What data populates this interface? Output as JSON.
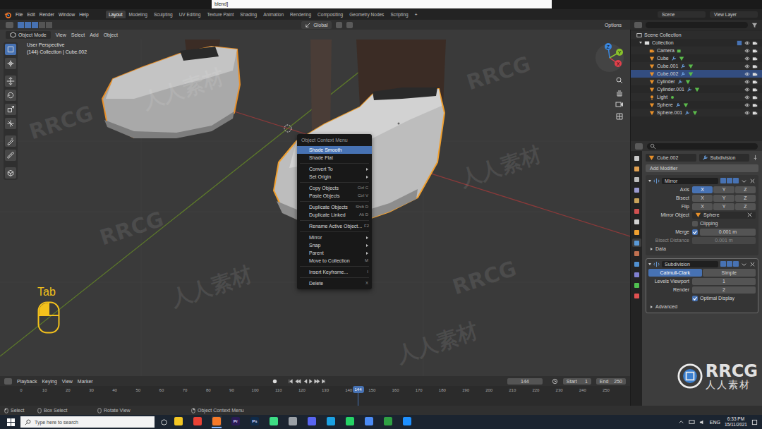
{
  "title_strip": {
    "text": "blend]"
  },
  "top_menu": [
    "File",
    "Edit",
    "Render",
    "Window",
    "Help"
  ],
  "workspaces": [
    {
      "label": "Layout",
      "selected": true
    },
    {
      "label": "Modeling",
      "selected": false
    },
    {
      "label": "Sculpting",
      "selected": false
    },
    {
      "label": "UV Editing",
      "selected": false
    },
    {
      "label": "Texture Paint",
      "selected": false
    },
    {
      "label": "Shading",
      "selected": false
    },
    {
      "label": "Animation",
      "selected": false
    },
    {
      "label": "Rendering",
      "selected": false
    },
    {
      "label": "Compositing",
      "selected": false
    },
    {
      "label": "Geometry Nodes",
      "selected": false
    },
    {
      "label": "Scripting",
      "selected": false
    }
  ],
  "add_workspace": "+",
  "scene": "Scene",
  "view_layer": "View Layer",
  "tool_header": {
    "orientation": "Global",
    "options": "Options"
  },
  "viewport_header": {
    "mode": "Object Mode",
    "menus": [
      "View",
      "Select",
      "Add",
      "Object"
    ]
  },
  "viewport": {
    "perspective": "User Perspective",
    "info": "(144) Collection | Cube.002",
    "gizmo": [
      {
        "axis": "X",
        "color": "#e2404c"
      },
      {
        "axis": "Y",
        "color": "#8ac22b"
      },
      {
        "axis": "Z",
        "color": "#3a87e0"
      }
    ]
  },
  "tools": [
    {
      "selected": true
    },
    {
      "selected": false
    },
    {
      "selected": false
    },
    {
      "selected": false
    },
    {
      "selected": false
    },
    {
      "selected": false
    },
    {
      "selected": false
    },
    {
      "selected": false
    },
    {
      "selected": false
    }
  ],
  "context_menu": {
    "title": "Object Context Menu",
    "items": [
      {
        "kind": "item",
        "label": "Shade Smooth",
        "shortcut": "",
        "submenu": false,
        "selected": true
      },
      {
        "kind": "item",
        "label": "Shade Flat",
        "shortcut": "",
        "submenu": false,
        "selected": false
      },
      {
        "kind": "separator"
      },
      {
        "kind": "item",
        "label": "Convert To",
        "shortcut": "",
        "submenu": true,
        "selected": false
      },
      {
        "kind": "item",
        "label": "Set Origin",
        "shortcut": "",
        "submenu": true,
        "selected": false
      },
      {
        "kind": "separator"
      },
      {
        "kind": "item",
        "label": "Copy Objects",
        "shortcut": "Ctrl C",
        "submenu": false,
        "selected": false
      },
      {
        "kind": "item",
        "label": "Paste Objects",
        "shortcut": "Ctrl V",
        "submenu": false,
        "selected": false
      },
      {
        "kind": "separator"
      },
      {
        "kind": "item",
        "label": "Duplicate Objects",
        "shortcut": "Shift D",
        "submenu": false,
        "selected": false
      },
      {
        "kind": "item",
        "label": "Duplicate Linked",
        "shortcut": "Alt D",
        "submenu": false,
        "selected": false
      },
      {
        "kind": "separator"
      },
      {
        "kind": "item",
        "label": "Rename Active Object...",
        "shortcut": "F2",
        "submenu": false,
        "selected": false
      },
      {
        "kind": "separator"
      },
      {
        "kind": "item",
        "label": "Mirror",
        "shortcut": "",
        "submenu": true,
        "selected": false
      },
      {
        "kind": "item",
        "label": "Snap",
        "shortcut": "",
        "submenu": true,
        "selected": false
      },
      {
        "kind": "item",
        "label": "Parent",
        "shortcut": "",
        "submenu": true,
        "selected": false
      },
      {
        "kind": "item",
        "label": "Move to Collection",
        "shortcut": "M",
        "submenu": false,
        "selected": false
      },
      {
        "kind": "separator"
      },
      {
        "kind": "item",
        "label": "Insert Keyframe...",
        "shortcut": "I",
        "submenu": false,
        "selected": false
      },
      {
        "kind": "separator"
      },
      {
        "kind": "item",
        "label": "Delete",
        "shortcut": "X",
        "submenu": false,
        "selected": false
      }
    ]
  },
  "keystroke": {
    "key": "Tab",
    "left_button": true,
    "right_button": false
  },
  "outliner": {
    "root": "Scene Collection",
    "collection": "Collection",
    "items": [
      {
        "name": "Camera",
        "kind": "camera",
        "selected": false
      },
      {
        "name": "Cube",
        "kind": "mesh",
        "selected": false
      },
      {
        "name": "Cube.001",
        "kind": "mesh",
        "selected": false
      },
      {
        "name": "Cube.002",
        "kind": "mesh",
        "selected": true
      },
      {
        "name": "Cylinder",
        "kind": "mesh",
        "selected": false
      },
      {
        "name": "Cylinder.001",
        "kind": "mesh",
        "selected": false
      },
      {
        "name": "Light",
        "kind": "light",
        "selected": false
      },
      {
        "name": "Sphere",
        "kind": "mesh",
        "selected": false
      },
      {
        "name": "Sphere.001",
        "kind": "mesh",
        "selected": false
      }
    ]
  },
  "property_tabs": [
    {
      "color": "#c8c8c8",
      "selected": false
    },
    {
      "color": "#e0a050",
      "selected": false
    },
    {
      "color": "#bdbdbd",
      "selected": false
    },
    {
      "color": "#9a9ad0",
      "selected": false
    },
    {
      "color": "#c9a35a",
      "selected": false
    },
    {
      "color": "#d05050",
      "selected": false
    },
    {
      "color": "#d0d0d0",
      "selected": false
    },
    {
      "color": "#f0a030",
      "selected": false
    },
    {
      "color": "#5a9ad8",
      "selected": true
    },
    {
      "color": "#c07050",
      "selected": false
    },
    {
      "color": "#5090d0",
      "selected": false
    },
    {
      "color": "#8080d0",
      "selected": false
    },
    {
      "color": "#50c050",
      "selected": false
    },
    {
      "color": "#e05050",
      "selected": false
    }
  ],
  "properties": {
    "object": "Cube.002",
    "active_modifier": "Subdivision",
    "add_modifier": "Add Modifier",
    "modifiers": [
      {
        "name": "Mirror",
        "expanded": true,
        "selected": false,
        "rows": [
          {
            "kind": "toggles",
            "label": "Axis",
            "options": [
              {
                "label": "X",
                "selected": true
              },
              {
                "label": "Y",
                "selected": false
              },
              {
                "label": "Z",
                "selected": false
              }
            ]
          },
          {
            "kind": "toggles",
            "label": "Bisect",
            "options": [
              {
                "label": "X",
                "selected": false
              },
              {
                "label": "Y",
                "selected": false
              },
              {
                "label": "Z",
                "selected": false
              }
            ]
          },
          {
            "kind": "toggles",
            "label": "Flip",
            "options": [
              {
                "label": "X",
                "selected": false
              },
              {
                "label": "Y",
                "selected": false
              },
              {
                "label": "Z",
                "selected": false
              }
            ]
          },
          {
            "kind": "object",
            "label": "Mirror Object",
            "value": "Sphere"
          },
          {
            "kind": "checkbox",
            "label": "Clipping",
            "checked": false
          },
          {
            "kind": "check-value",
            "label": "Merge",
            "checked": true,
            "value": "0.001 m"
          },
          {
            "kind": "value",
            "label": "Bisect Distance",
            "value": "0.001 m",
            "disabled": true
          },
          {
            "kind": "section",
            "label": "Data",
            "expanded": false
          }
        ]
      },
      {
        "name": "Subdivision",
        "expanded": true,
        "selected": true,
        "rows": [
          {
            "kind": "segmented",
            "options": [
              {
                "label": "Catmull-Clark",
                "selected": true
              },
              {
                "label": "Simple",
                "selected": false
              }
            ]
          },
          {
            "kind": "value",
            "label": "Levels Viewport",
            "value": "1",
            "disabled": false
          },
          {
            "kind": "value",
            "label": "Render",
            "value": "2",
            "disabled": false
          },
          {
            "kind": "checkbox",
            "label": "Optimal Display",
            "checked": true
          },
          {
            "kind": "section",
            "label": "Advanced",
            "expanded": false
          }
        ]
      }
    ]
  },
  "timeline": {
    "menus": [
      "Playback",
      "Keying",
      "View",
      "Marker"
    ],
    "frame": "144",
    "start_label": "Start",
    "start": "1",
    "end_label": "End",
    "end": "250",
    "ticks": [
      "0",
      "10",
      "20",
      "30",
      "40",
      "50",
      "60",
      "70",
      "80",
      "90",
      "100",
      "110",
      "120",
      "130",
      "140",
      "150",
      "160",
      "170",
      "180",
      "190",
      "200",
      "210",
      "220",
      "230",
      "240",
      "250"
    ],
    "playhead": "144",
    "level": 0.576
  },
  "status_bar": [
    "Select",
    "Box Select",
    "Rotate View",
    "Object Context Menu"
  ],
  "taskbar": {
    "search": "Type here to search",
    "language": "ENG",
    "time": "6:33 PM",
    "date": "15/11/2021",
    "apps": [
      {
        "label": "",
        "color": "#f3c623",
        "active": false
      },
      {
        "label": "",
        "color": "#e94235",
        "active": false
      },
      {
        "label": "",
        "color": "#f5792a",
        "active": true
      },
      {
        "label": "Pr",
        "color": "#2a1b57",
        "active": false
      },
      {
        "label": "Ps",
        "color": "#0f2b4a",
        "active": false
      },
      {
        "label": "",
        "color": "#3ddc84",
        "active": false
      },
      {
        "label": "",
        "color": "#9aa0a6",
        "active": false
      },
      {
        "label": "",
        "color": "#5865f2",
        "active": false
      },
      {
        "label": "",
        "color": "#1ba1e2",
        "active": false
      },
      {
        "label": "",
        "color": "#25d366",
        "active": false
      },
      {
        "label": "",
        "color": "#4b8bf5",
        "active": false
      },
      {
        "label": "",
        "color": "#2ea043",
        "active": false
      },
      {
        "label": "",
        "color": "#1e90ff",
        "active": false
      }
    ]
  },
  "watermark": {
    "texts": [
      "RRCG",
      "人人素材"
    ],
    "logo": "RRCG",
    "logo_sub": "人人素材"
  }
}
